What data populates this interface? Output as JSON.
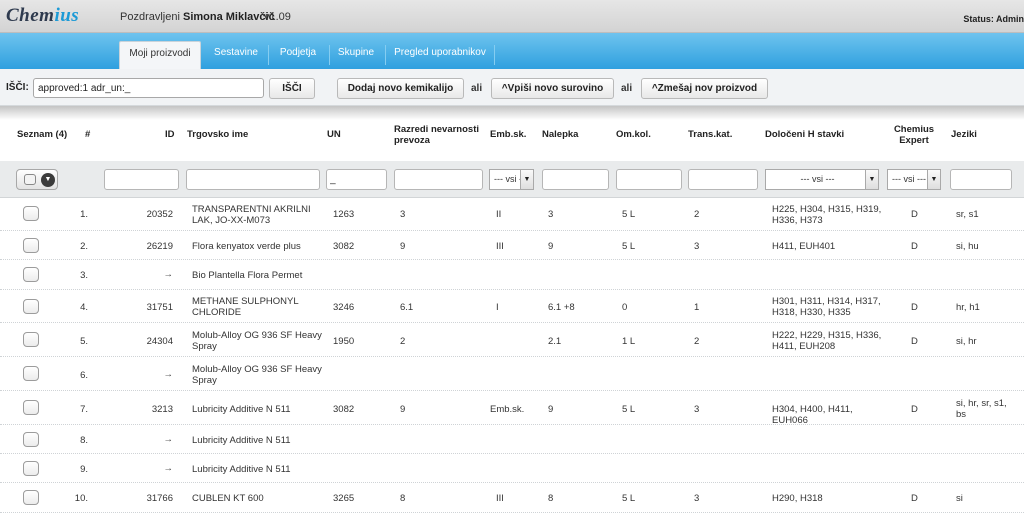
{
  "header": {
    "logo_main": "Chem",
    "logo_accent": "ius",
    "greeting": "Pozdravljeni",
    "user_name": "Simona Miklavčič",
    "version": "v1.09",
    "status": "Status: Admin"
  },
  "nav": {
    "tabs": [
      {
        "label": "Moji proizvodi",
        "active": true
      },
      {
        "label": "Sestavine",
        "active": false
      },
      {
        "label": "Podjetja",
        "active": false
      },
      {
        "label": "Skupine",
        "active": false
      },
      {
        "label": "Pregled uporabnikov",
        "active": false
      }
    ]
  },
  "search": {
    "label": "IŠČI:",
    "value": "approved:1 adr_un:_",
    "search_button": "IŠČI",
    "add_chemical_button": "Dodaj novo kemikalijo",
    "or_1": "ali",
    "enter_raw_button": "^Vpiši novo surovino",
    "or_2": "ali",
    "mix_product_button": "^Zmešaj nov proizvod"
  },
  "columns": {
    "list": "Seznam (4)",
    "num": "#",
    "id": "ID",
    "trade_name": "Trgovsko ime",
    "un": "UN",
    "hazard_classes": "Razredi nevarnosti prevoza",
    "pack_group": "Emb.sk.",
    "label": "Nalepka",
    "lim_qty": "Om.kol.",
    "trans_cat": "Trans.kat.",
    "h_statements": "Določeni H stavki",
    "chemius_expert": "Chemius Expert",
    "languages": "Jeziki"
  },
  "filters": {
    "un_value": "_",
    "pack_group_select": "--- vsi ---",
    "h_statements_select": "--- vsi ---",
    "expert_select": "--- vsi ---"
  },
  "rows": [
    {
      "num": "1.",
      "id": "20352",
      "name": "TRANSPARENTNI AKRILNI LAK, JO-XX-M073",
      "un": "1263",
      "haz": "3",
      "pg": "II",
      "label": "3",
      "lq": "5 L",
      "tc": "2",
      "h": "H225, H304, H315, H319, H336, H373",
      "exp": "D",
      "lang": "sr, s1"
    },
    {
      "num": "2.",
      "id": "26219",
      "name": "Flora kenyatox verde plus",
      "un": "3082",
      "haz": "9",
      "pg": "III",
      "label": "9",
      "lq": "5 L",
      "tc": "3",
      "h": "H411, EUH401",
      "exp": "D",
      "lang": "si, hu"
    },
    {
      "num": "3.",
      "id": "→",
      "name": "Bio Plantella Flora Permet",
      "un": "",
      "haz": "",
      "pg": "",
      "label": "",
      "lq": "",
      "tc": "",
      "h": "",
      "exp": "",
      "lang": ""
    },
    {
      "num": "4.",
      "id": "31751",
      "name": "METHANE SULPHONYL CHLORIDE",
      "un": "3246",
      "haz": "6.1",
      "pg": "I",
      "label": "6.1 +8",
      "lq": "0",
      "tc": "1",
      "h": "H301, H311, H314, H317, H318, H330, H335",
      "exp": "D",
      "lang": "hr, h1"
    },
    {
      "num": "5.",
      "id": "24304",
      "name": "Molub-Alloy OG 936 SF Heavy Spray",
      "un": "1950",
      "haz": "2",
      "pg": "",
      "label": "2.1",
      "lq": "1 L",
      "tc": "2",
      "h": "H222, H229, H315, H336, H411, EUH208",
      "exp": "D",
      "lang": "si, hr"
    },
    {
      "num": "6.",
      "id": "→",
      "name": "Molub-Alloy OG 936 SF Heavy Spray",
      "un": "",
      "haz": "",
      "pg": "",
      "label": "",
      "lq": "",
      "tc": "",
      "h": "",
      "exp": "",
      "lang": ""
    },
    {
      "num": "7.",
      "id": "3213",
      "name": "Lubricity Additive N 511",
      "un": "3082",
      "haz": "9",
      "pg": "Emb.sk.",
      "label": "9",
      "lq": "5 L",
      "tc": "3",
      "h": "H304, H400, H411, EUH066",
      "exp": "D",
      "lang": "si, hr, sr, s1, bs"
    },
    {
      "num": "8.",
      "id": "→",
      "name": "Lubricity Additive N 511",
      "un": "",
      "haz": "",
      "pg": "",
      "label": "",
      "lq": "",
      "tc": "",
      "h": "",
      "exp": "",
      "lang": ""
    },
    {
      "num": "9.",
      "id": "→",
      "name": "Lubricity Additive N 511",
      "un": "",
      "haz": "",
      "pg": "",
      "label": "",
      "lq": "",
      "tc": "",
      "h": "",
      "exp": "",
      "lang": ""
    },
    {
      "num": "10.",
      "id": "31766",
      "name": "CUBLEN KT 600",
      "un": "3265",
      "haz": "8",
      "pg": "III",
      "label": "8",
      "lq": "5 L",
      "tc": "3",
      "h": "H290, H318",
      "exp": "D",
      "lang": "si"
    }
  ],
  "colors": {
    "accent_blue": "#2fa0df",
    "logo_dark": "#2e3a4e",
    "logo_accent": "#1c9ad6"
  }
}
